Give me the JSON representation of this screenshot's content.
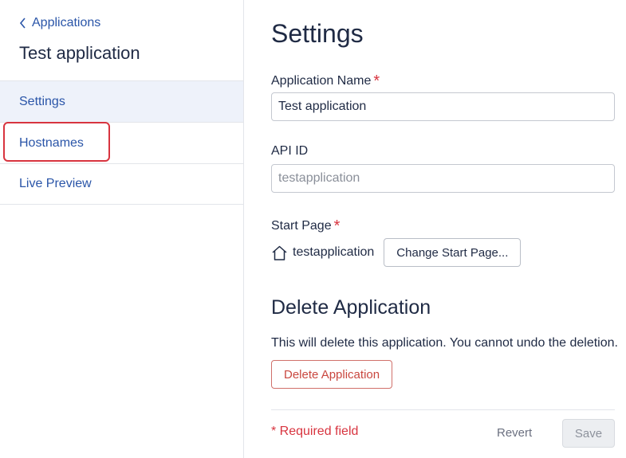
{
  "sidebar": {
    "back_label": "Applications",
    "app_title": "Test application",
    "items": [
      {
        "label": "Settings"
      },
      {
        "label": "Hostnames"
      },
      {
        "label": "Live Preview"
      }
    ]
  },
  "main": {
    "title": "Settings",
    "app_name": {
      "label": "Application Name",
      "required_mark": "*",
      "value": "Test application"
    },
    "api_id": {
      "label": "API ID",
      "placeholder": "testapplication"
    },
    "start_page": {
      "label": "Start Page",
      "required_mark": "*",
      "value": "testapplication",
      "change_button": "Change Start Page..."
    },
    "delete": {
      "title": "Delete Application",
      "description": "This will delete this application. You cannot undo the deletion.",
      "button": "Delete Application"
    },
    "footer": {
      "required_note": "* Required field",
      "revert": "Revert",
      "save": "Save"
    }
  },
  "colors": {
    "accent": "#2a55a8",
    "danger": "#d8343f",
    "active_bg": "#eef2fa"
  },
  "icons": {
    "back": "chevron-left-icon",
    "home": "home-icon"
  }
}
